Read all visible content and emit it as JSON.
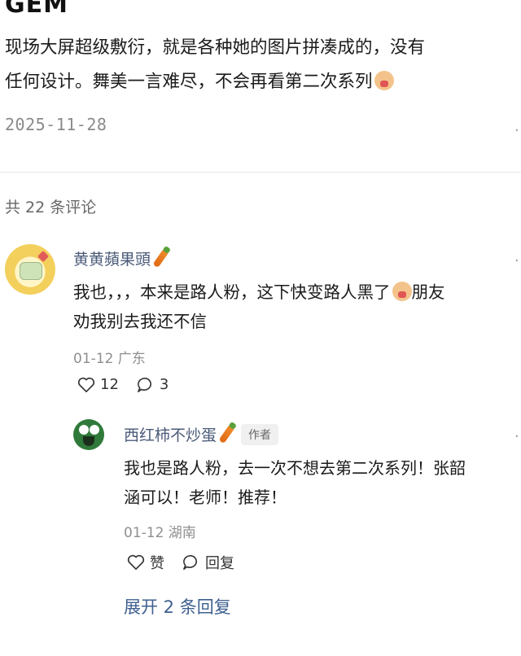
{
  "post": {
    "title_partial": "GEM",
    "body_lines": [
      "现场大屏超级敷衍，就是各种她的图片拼凑成的，没有",
      "任何设计。舞美一言难尽，不会再看第二次系列"
    ],
    "date": "2025-11-28"
  },
  "comments_header": "共 22 条评论",
  "comment1": {
    "username": "黄黄蘋果頭",
    "text_lines": [
      "我也，，，本来是路人粉，这下快变路人黑了",
      "朋友",
      "劝我别去我还不信"
    ],
    "meta": "01-12 广东",
    "likes": "12",
    "replies": "3"
  },
  "reply1": {
    "username": "西红柿不炒蛋",
    "badge": "作者",
    "text_lines": [
      "我也是路人粉，去一次不想去第二次系列！张韶",
      "涵可以！老师！推荐！"
    ],
    "meta": "01-12 湖南",
    "like_label": "赞",
    "reply_label": "回复"
  },
  "expand_label": "展开 2 条回复",
  "icons": [
    "sob-emoji",
    "carrot-icon",
    "heart-icon",
    "comment-bubble-icon",
    "more-dot-icon"
  ]
}
